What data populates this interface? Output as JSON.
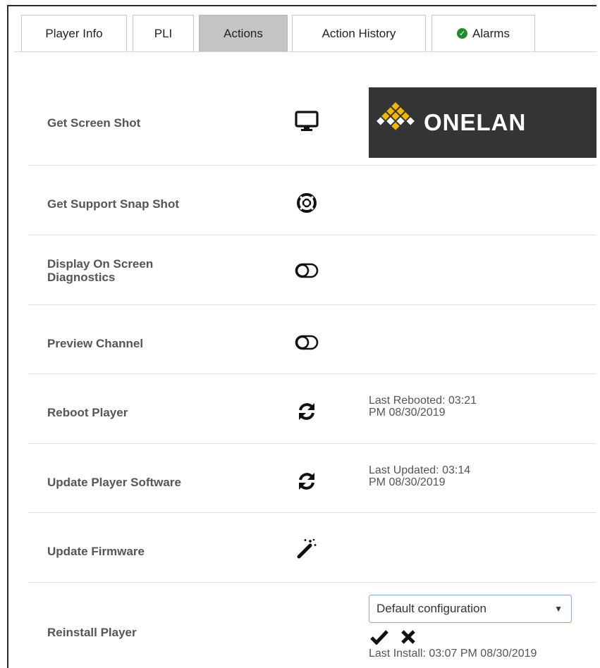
{
  "tabs": [
    {
      "label": "Player Info",
      "active": false
    },
    {
      "label": "PLI",
      "active": false
    },
    {
      "label": "Actions",
      "active": true
    },
    {
      "label": "Action History",
      "active": false
    },
    {
      "label": "Alarms",
      "active": false,
      "icon": "check-circle-icon"
    }
  ],
  "logo": {
    "text": "ONELAN"
  },
  "actions": [
    {
      "label": "Get Screen Shot",
      "icon": "monitor-icon"
    },
    {
      "label": "Get Support Snap Shot",
      "icon": "lifebuoy-icon"
    },
    {
      "label_lines": [
        "Display On Screen",
        "Diagnostics"
      ],
      "icon": "toggle-icon"
    },
    {
      "label": "Preview Channel",
      "icon": "toggle-icon"
    },
    {
      "label": "Reboot Player",
      "icon": "refresh-icon",
      "note_lines": [
        "Last Rebooted: 03:21",
        "PM 08/30/2019"
      ]
    },
    {
      "label": "Update Player Software",
      "icon": "refresh-icon",
      "note_lines": [
        "Last Updated: 03:14",
        "PM 08/30/2019"
      ]
    },
    {
      "label": "Update Firmware",
      "icon": "magic-wand-icon"
    },
    {
      "label": "Reinstall Player",
      "select_value": "Default configuration",
      "last_install": "Last Install: 03:07 PM 08/30/2019",
      "confirm_icon": "check-icon",
      "cancel_icon": "close-icon"
    }
  ],
  "colors": {
    "active_tab": "#c4c4c4",
    "logo_bg": "#333436",
    "logo_accent": "#f2b701",
    "alarm_ok": "#1f8a2e"
  }
}
